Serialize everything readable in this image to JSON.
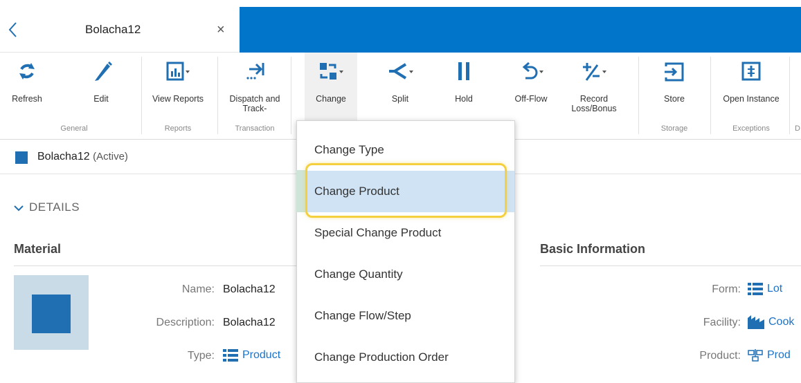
{
  "tab": {
    "title": "Bolacha12",
    "close": "×"
  },
  "ribbon": {
    "refresh": "Refresh",
    "edit": "Edit",
    "view_reports": "View Reports",
    "dispatch_track": "Dispatch and Track-",
    "change": "Change",
    "split": "Split",
    "hold": "Hold",
    "off_flow": "Off-Flow",
    "record_loss_bonus": "Record Loss/Bonus",
    "store": "Store",
    "open_instance": "Open Instance",
    "groups": {
      "general": "General",
      "reports": "Reports",
      "transaction": "Transaction",
      "storage": "Storage",
      "exceptions": "Exceptions",
      "cut": "D"
    }
  },
  "entity": {
    "name": "Bolacha12",
    "status": "(Active)"
  },
  "details": {
    "toggle": "DETAILS",
    "material": {
      "title": "Material",
      "name_label": "Name:",
      "name_value": "Bolacha12",
      "description_label": "Description:",
      "description_value": "Bolacha12",
      "type_label": "Type:",
      "type_value": "Product"
    },
    "basic": {
      "title": "Basic Information",
      "form_label": "Form:",
      "form_value": "Lot",
      "facility_label": "Facility:",
      "facility_value": "Cook",
      "product_label": "Product:",
      "product_value": "Prod"
    }
  },
  "menu": {
    "items": [
      "Change Type",
      "Change Product",
      "Special Change Product",
      "Change Quantity",
      "Change Flow/Step",
      "Change Production Order"
    ],
    "highlighted_index": 1
  },
  "colors": {
    "accent": "#0075c9",
    "highlight": "#cfe3f5",
    "focus": "#f4d03f",
    "link": "#1a73c9"
  }
}
